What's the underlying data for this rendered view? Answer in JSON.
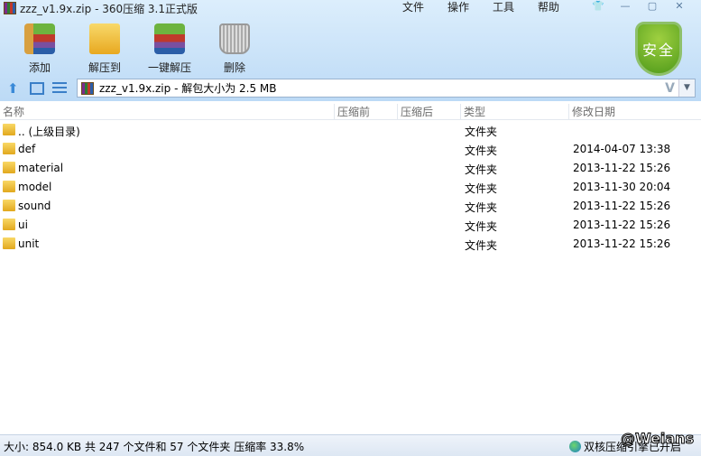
{
  "window": {
    "title": "zzz_v1.9x.zip - 360压缩 3.1正式版"
  },
  "menu": [
    "文件",
    "操作",
    "工具",
    "帮助"
  ],
  "toolbar": [
    {
      "label": "添加",
      "icon": "add-archive-icon"
    },
    {
      "label": "解压到",
      "icon": "extract-to-icon"
    },
    {
      "label": "一键解压",
      "icon": "one-click-extract-icon"
    },
    {
      "label": "删除",
      "icon": "trash-icon"
    }
  ],
  "security_badge": "安全",
  "address": {
    "value": "zzz_v1.9x.zip - 解包大小为 2.5 MB",
    "v_label": "V"
  },
  "columns": [
    "名称",
    "压缩前",
    "压缩后",
    "类型",
    "修改日期"
  ],
  "rows": [
    {
      "name": ".. (上级目录)",
      "type": "文件夹",
      "date": ""
    },
    {
      "name": "def",
      "type": "文件夹",
      "date": "2014-04-07 13:38"
    },
    {
      "name": "material",
      "type": "文件夹",
      "date": "2013-11-22 15:26"
    },
    {
      "name": "model",
      "type": "文件夹",
      "date": "2013-11-30 20:04"
    },
    {
      "name": "sound",
      "type": "文件夹",
      "date": "2013-11-22 15:26"
    },
    {
      "name": "ui",
      "type": "文件夹",
      "date": "2013-11-22 15:26"
    },
    {
      "name": "unit",
      "type": "文件夹",
      "date": "2013-11-22 15:26"
    }
  ],
  "status": {
    "left": "大小: 854.0 KB 共 247 个文件和 57 个文件夹 压缩率 33.8%",
    "right": "双核压缩引擎已开启"
  },
  "watermark": "@Weians"
}
